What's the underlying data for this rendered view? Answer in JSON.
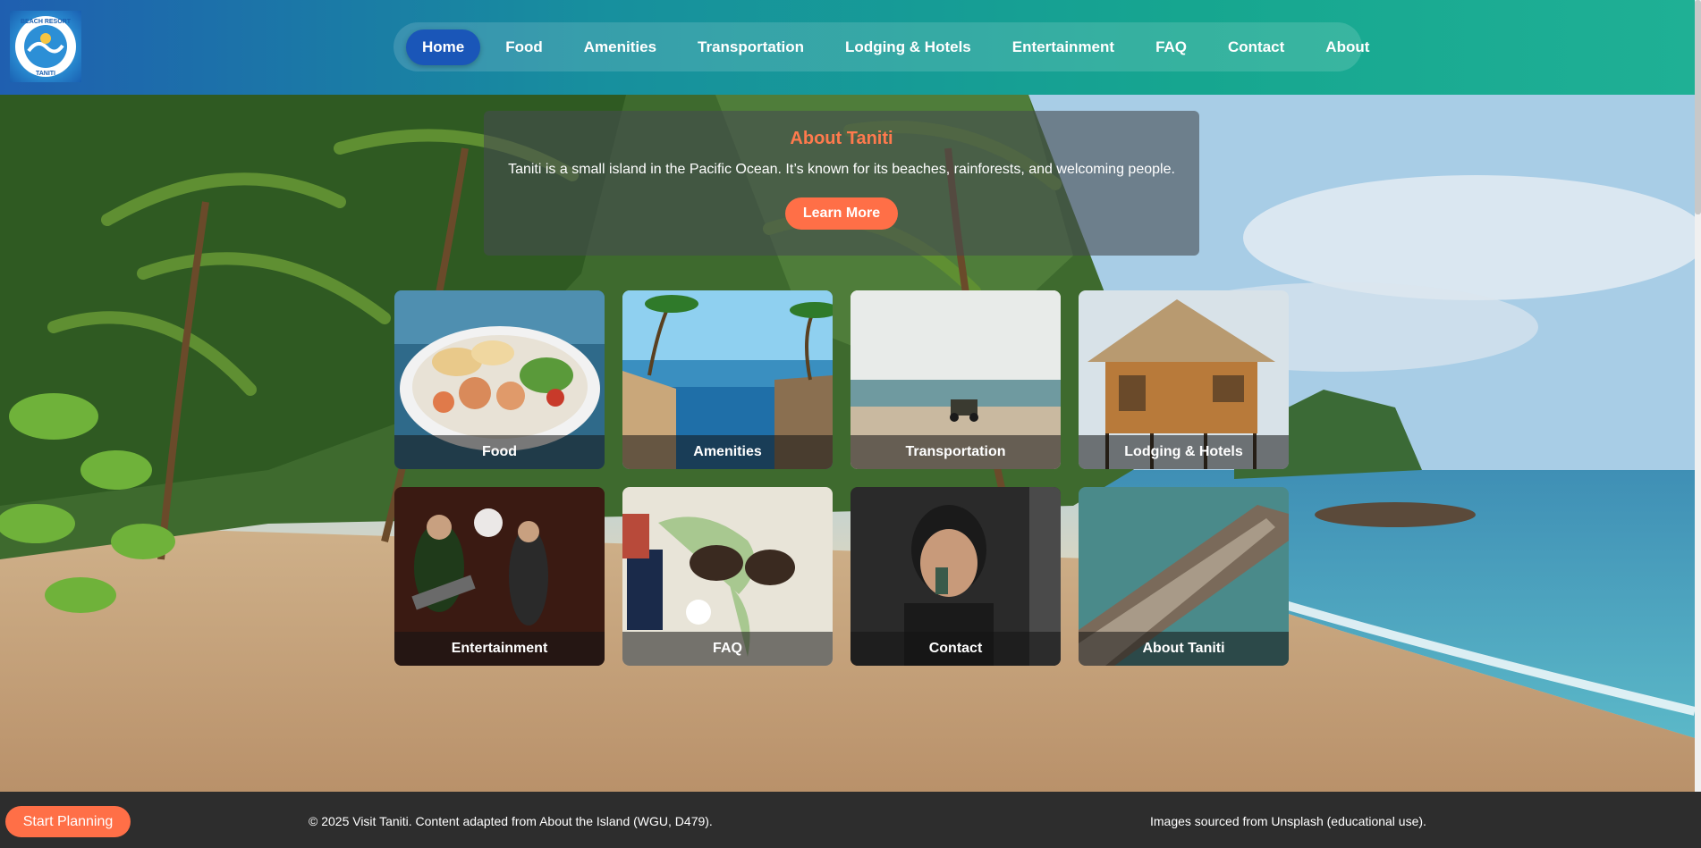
{
  "colors": {
    "accent": "#ff6f47",
    "nav_active": "#1a56b8",
    "heading": "#ff7a4d",
    "footer_bg": "#2d2d2d"
  },
  "logo": {
    "text_top": "BEACH RESORT",
    "text_bottom": "TANITI"
  },
  "nav": {
    "items": [
      {
        "label": "Home",
        "active": true
      },
      {
        "label": "Food"
      },
      {
        "label": "Amenities"
      },
      {
        "label": "Transportation"
      },
      {
        "label": "Lodging & Hotels"
      },
      {
        "label": "Entertainment"
      },
      {
        "label": "FAQ"
      },
      {
        "label": "Contact"
      },
      {
        "label": "About"
      }
    ]
  },
  "about": {
    "title": "About Taniti",
    "text": "Taniti is a small island in the Pacific Ocean. It’s known for its beaches, rainforests, and welcoming people.",
    "button": "Learn More"
  },
  "tiles": [
    {
      "label": "Food",
      "icon": "food-plate-image"
    },
    {
      "label": "Amenities",
      "icon": "infinity-pool-image"
    },
    {
      "label": "Transportation",
      "icon": "beach-jeep-image"
    },
    {
      "label": "Lodging & Hotels",
      "icon": "thatched-hut-image"
    },
    {
      "label": "Entertainment",
      "icon": "live-band-image"
    },
    {
      "label": "FAQ",
      "icon": "map-passport-image"
    },
    {
      "label": "Contact",
      "icon": "phone-call-image"
    },
    {
      "label": "About Taniti",
      "icon": "aerial-coast-image"
    }
  ],
  "footer": {
    "start_button": "Start Planning",
    "copyright": "© 2025 Visit Taniti. Content adapted from About the Island (WGU, D479).",
    "credits": "Images sourced from Unsplash (educational use)."
  }
}
